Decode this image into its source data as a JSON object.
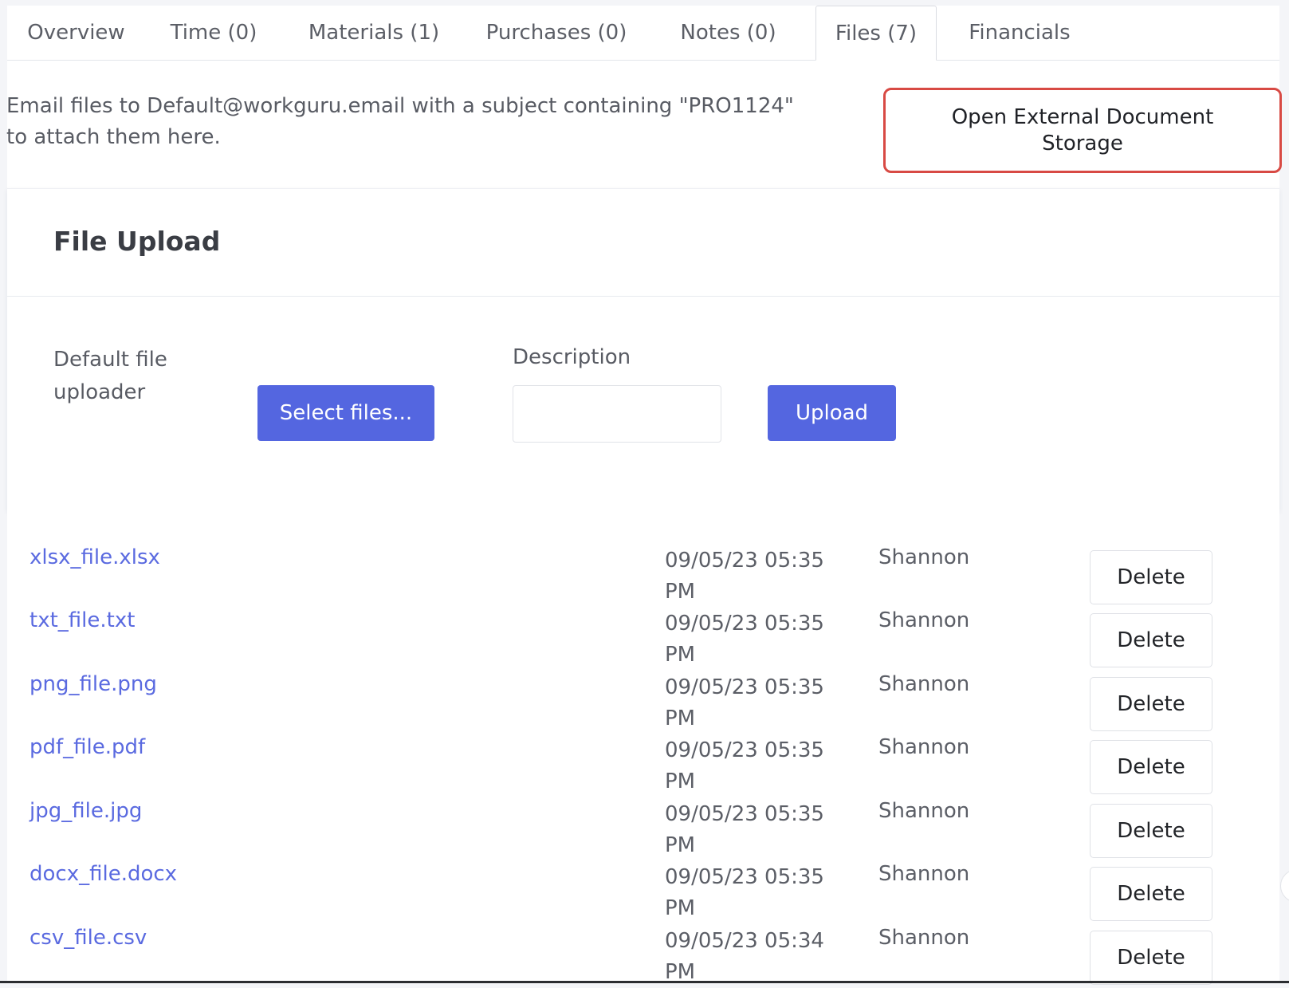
{
  "tabs": [
    {
      "label": "Overview"
    },
    {
      "label": "Time (0)"
    },
    {
      "label": "Materials (1)"
    },
    {
      "label": "Purchases (0)"
    },
    {
      "label": "Notes (0)"
    },
    {
      "label": "Files (7)",
      "active": true
    },
    {
      "label": "Financials"
    }
  ],
  "hint": {
    "text": "Email files to Default@workguru.email with a subject containing \"PRO1124\" to attach them here."
  },
  "external_button": {
    "label": "Open External Document Storage"
  },
  "upload": {
    "title": "File Upload",
    "uploader_label": "Default file uploader",
    "select_label": "Select files...",
    "description_label": "Description",
    "description_value": "",
    "upload_label": "Upload"
  },
  "files": [
    {
      "name": "xlsx_file.xlsx",
      "date": "09/05/23 05:35 PM",
      "user": "Shannon",
      "action": "Delete"
    },
    {
      "name": "txt_file.txt",
      "date": "09/05/23 05:35 PM",
      "user": "Shannon",
      "action": "Delete"
    },
    {
      "name": "png_file.png",
      "date": "09/05/23 05:35 PM",
      "user": "Shannon",
      "action": "Delete"
    },
    {
      "name": "pdf_file.pdf",
      "date": "09/05/23 05:35 PM",
      "user": "Shannon",
      "action": "Delete"
    },
    {
      "name": "jpg_file.jpg",
      "date": "09/05/23 05:35 PM",
      "user": "Shannon",
      "action": "Delete"
    },
    {
      "name": "docx_file.docx",
      "date": "09/05/23 05:35 PM",
      "user": "Shannon",
      "action": "Delete"
    },
    {
      "name": "csv_file.csv",
      "date": "09/05/23 05:34 PM",
      "user": "Shannon",
      "action": "Delete"
    }
  ],
  "colors": {
    "accent": "#5466e0",
    "link": "#5a6ae0",
    "highlight_border": "#d84a44"
  }
}
